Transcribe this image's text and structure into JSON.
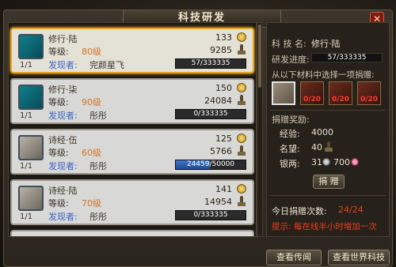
{
  "window": {
    "title": "科技研发",
    "close_label": "✕"
  },
  "tech_list": [
    {
      "count": "1/1",
      "name": "修行·陆",
      "level_label": "等级:",
      "level": "80级",
      "discoverer_label": "发现者:",
      "discoverer": "完颜星飞",
      "value1": "133",
      "value2": "9285",
      "progress_text": "57/333335",
      "progress_fraction": 0.0002,
      "selected": true,
      "icon": "martial-art-icon"
    },
    {
      "count": "1/1",
      "name": "修行·柒",
      "level_label": "等级:",
      "level": "90级",
      "discoverer_label": "发现者:",
      "discoverer": "彤彤",
      "value1": "150",
      "value2": "24084",
      "progress_text": "0/333335",
      "progress_fraction": 0,
      "selected": false,
      "icon": "martial-art-icon"
    },
    {
      "count": "1/1",
      "name": "诗经·伍",
      "level_label": "等级:",
      "level": "60级",
      "discoverer_label": "发现者:",
      "discoverer": "彤彤",
      "value1": "125",
      "value2": "5766",
      "progress_text": "24459/50000",
      "progress_fraction": 0.489,
      "selected": false,
      "icon": "book-icon"
    },
    {
      "count": "1/1",
      "name": "诗经·陆",
      "level_label": "等级:",
      "level": "70级",
      "discoverer_label": "发现者:",
      "discoverer": "彤彤",
      "value1": "141",
      "value2": "14954",
      "progress_text": "0/333335",
      "progress_fraction": 0,
      "selected": false,
      "icon": "book-icon"
    }
  ],
  "detail": {
    "name_label": "科 技 名:",
    "name": "修行·陆",
    "progress_label": "研发进度:",
    "progress_text": "57/333335",
    "choose_label": "从以下材料中选择一项捐赠:",
    "materials": [
      {
        "icon": "scroll-icon",
        "count": "",
        "selected": true
      },
      {
        "icon": "leather-icon",
        "count": "0/20",
        "selected": false
      },
      {
        "icon": "armor-icon",
        "count": "0/20",
        "selected": false
      },
      {
        "icon": "sword-icon",
        "count": "0/20",
        "selected": false
      }
    ],
    "reward_label": "捐赠奖励:",
    "exp_label": "经验:",
    "exp": "4000",
    "fame_label": "名望:",
    "fame": "40",
    "silver_label": "银两:",
    "silver": "31",
    "silver2": "700",
    "donate_label": "捐 赠",
    "daily_label": "今日捐赠次数:",
    "daily": "24/24",
    "tip": "提示: 每在线半小时增加一次"
  },
  "buttons": {
    "view_legend": "查看传闻",
    "view_world": "查看世界科技"
  },
  "colors": {
    "selected_border": "#e8a324",
    "progress_blue": "#3f76c7",
    "warning_red": "#e8421f",
    "level_orange": "#d27326"
  }
}
